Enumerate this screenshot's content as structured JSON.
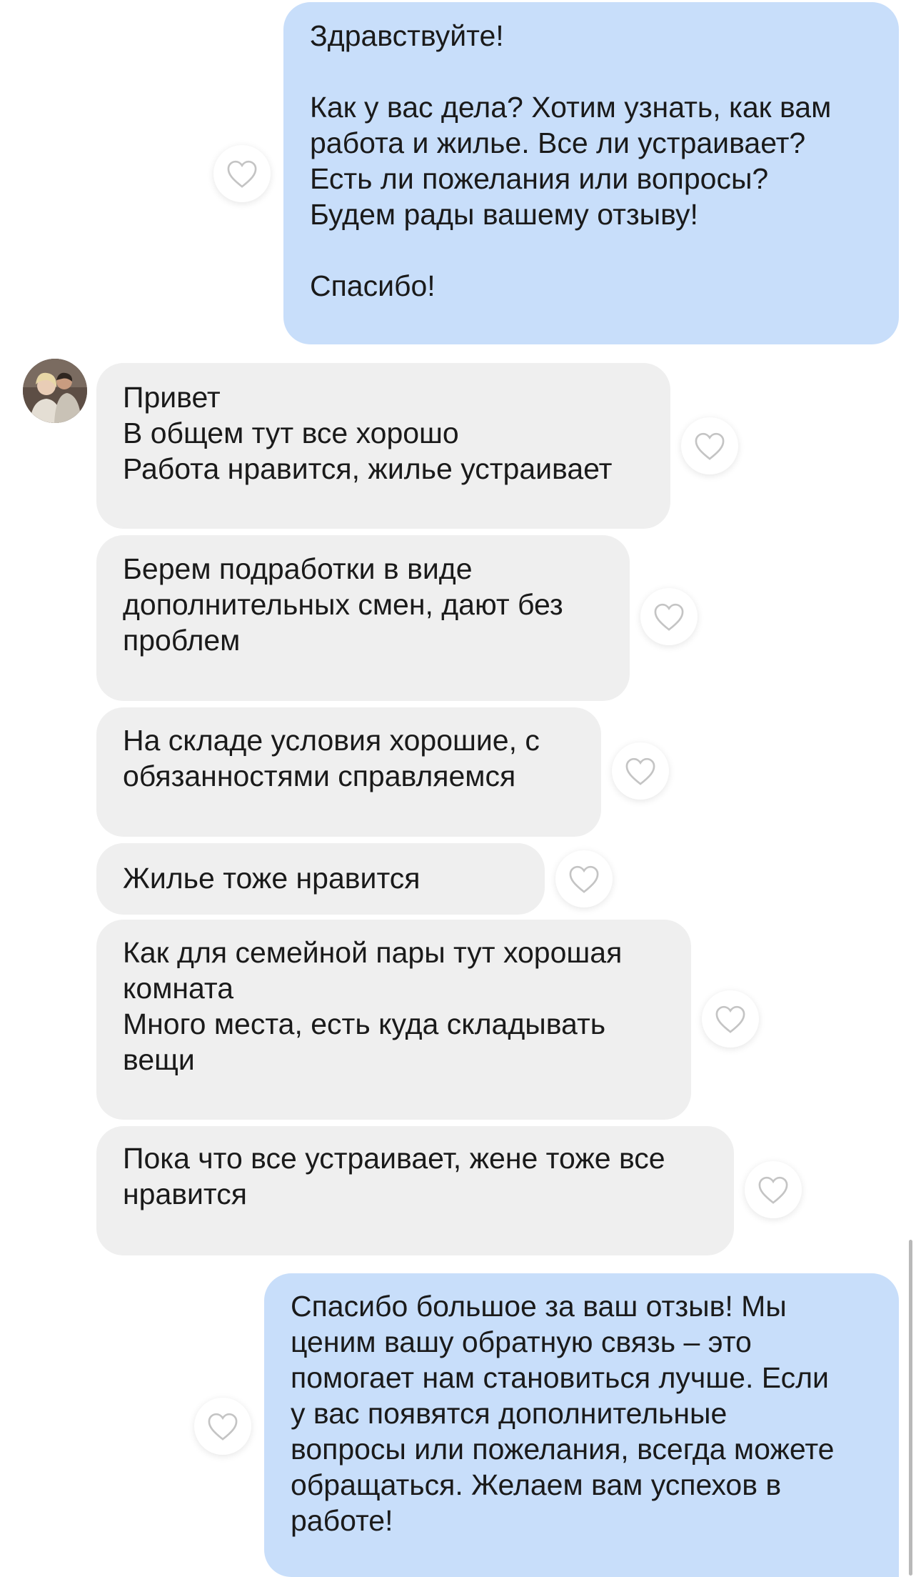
{
  "messages": [
    {
      "sender": "business",
      "text": "Здравствуйте!\n\nКак у вас дела? Хотим узнать, как вам\nработа и жилье. Все ли устраивает?\nЕсть ли пожелания или вопросы?\nБудем рады вашему отзыву!\n\nСпасибо!"
    },
    {
      "sender": "customer",
      "text": "Привет\nВ общем тут все хорошо\nРабота нравится, жилье устраивает"
    },
    {
      "sender": "customer",
      "text": "Берем подработки в виде\nдополнительных смен, дают без\nпроблем"
    },
    {
      "sender": "customer",
      "text": "На складе условия хорошие, с\nобязанностями справляемся"
    },
    {
      "sender": "customer",
      "text": "Жилье тоже нравится"
    },
    {
      "sender": "customer",
      "text": "Как для семейной пары тут хорошая\nкомната\nМного места, есть куда складывать\nвещи"
    },
    {
      "sender": "customer",
      "text": "Пока что все устраивает, жене тоже все\nнравится"
    },
    {
      "sender": "business",
      "text": "Спасибо большое за ваш отзыв! Мы\nценим вашу обратную связь – это\nпомогает нам становиться лучше. Если\nу вас появятся дополнительные\nвопросы или пожелания, всегда можете\nобращаться. Желаем вам успехов в\nработе!"
    }
  ],
  "icons": {
    "reaction": "heart-outline-icon",
    "avatar": "customer-avatar"
  },
  "colors": {
    "outgoing_bubble": "#c8defa",
    "incoming_bubble": "#efefef",
    "heart_stroke": "#c4c4c4"
  }
}
